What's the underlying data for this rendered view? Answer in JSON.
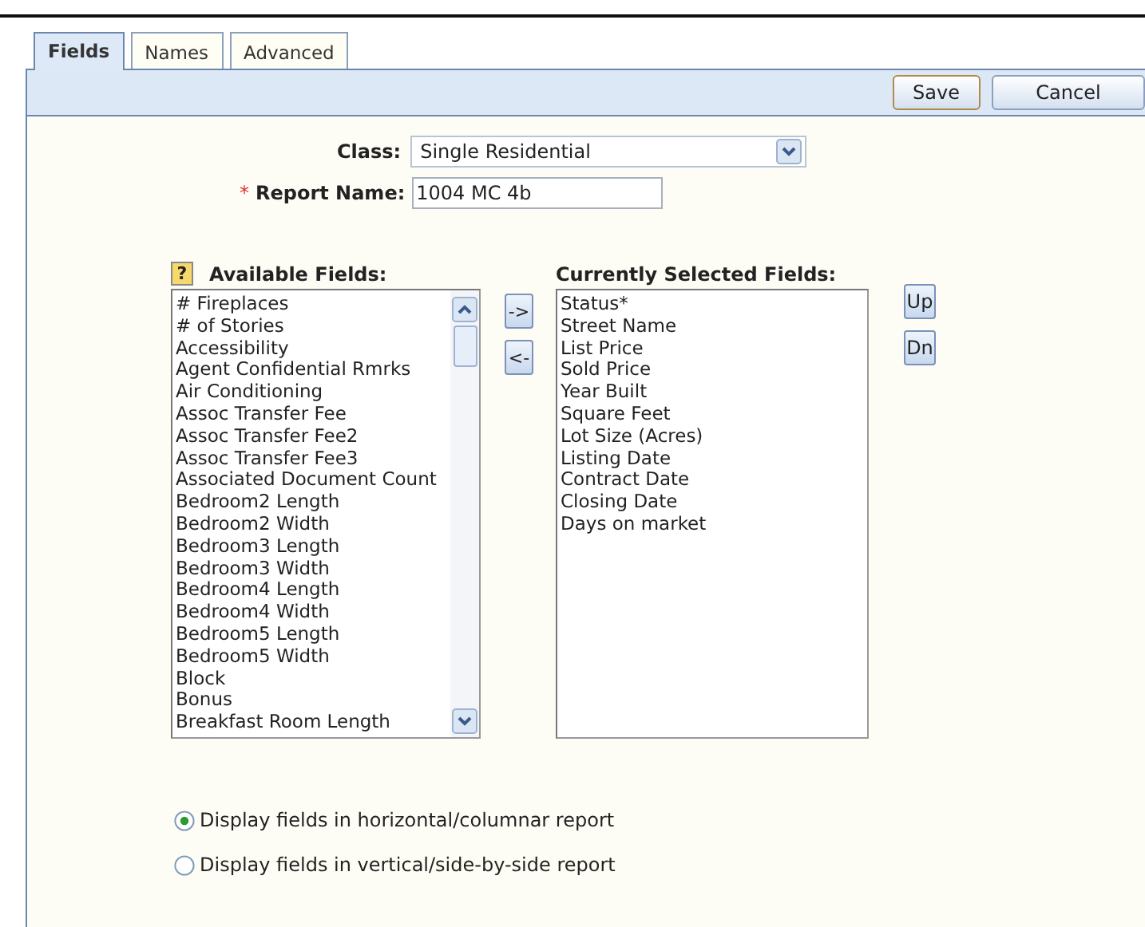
{
  "tabs": [
    {
      "label": "Fields",
      "selected": true
    },
    {
      "label": "Names",
      "selected": false
    },
    {
      "label": "Advanced",
      "selected": false
    }
  ],
  "toolbar": {
    "buttons": [
      {
        "label": "Save",
        "kind": "primary"
      },
      {
        "label": "Cancel",
        "kind": "normal"
      }
    ]
  },
  "form": {
    "class": {
      "label": "Class:",
      "value": "Single Residential"
    },
    "report_name": {
      "required_mark": "*",
      "label": "Report Name:",
      "value": "1004 MC 4b"
    }
  },
  "available": {
    "help": "?",
    "label": "Available Fields:",
    "items": [
      "# Fireplaces",
      "# of Stories",
      "Accessibility",
      "Agent Confidential Rmrks",
      "Air Conditioning",
      "Assoc Transfer Fee",
      "Assoc Transfer Fee2",
      "Assoc Transfer Fee3",
      "Associated Document Count",
      "Bedroom2 Length",
      "Bedroom2 Width",
      "Bedroom3 Length",
      "Bedroom3 Width",
      "Bedroom4 Length",
      "Bedroom4 Width",
      "Bedroom5 Length",
      "Bedroom5 Width",
      "Block",
      "Bonus",
      "Breakfast Room Length"
    ]
  },
  "move_buttons": [
    "->",
    "<-"
  ],
  "selected": {
    "label": "Currently Selected Fields:",
    "items": [
      "Status*",
      "Street Name",
      "List Price",
      "Sold Price",
      "Year Built",
      "Square Feet",
      "Lot Size (Acres)",
      "Listing Date",
      "Contract Date",
      "Closing Date",
      "Days on market"
    ]
  },
  "order_buttons": [
    "Up",
    "Dn"
  ],
  "layout_options": [
    {
      "label": "Display fields in horizontal/columnar report",
      "selected": true
    },
    {
      "label": "Display fields in vertical/side-by-side report",
      "selected": false
    }
  ]
}
